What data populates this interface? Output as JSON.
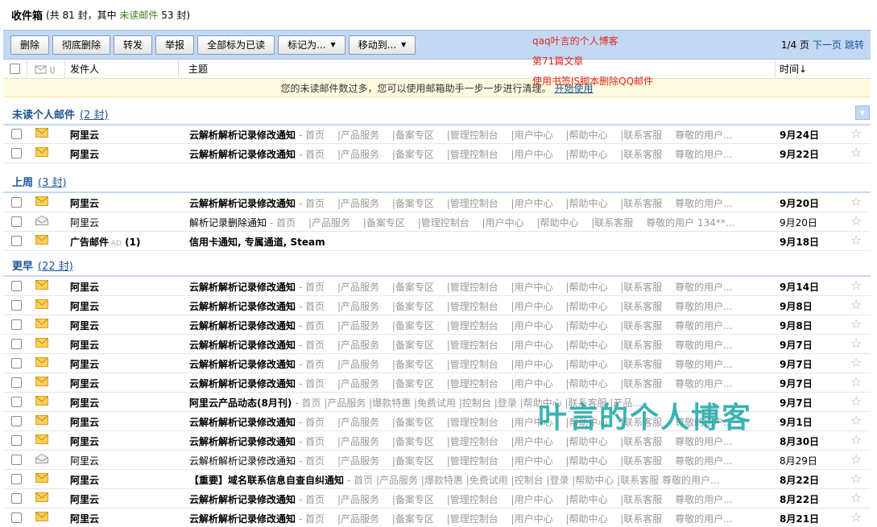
{
  "topbar": {
    "title": "收件箱",
    "summary_prefix": "(共 81 封，其中 ",
    "unread_label": "未读邮件",
    "summary_suffix": " 53 封)"
  },
  "toolbar": {
    "delete": "删除",
    "perm_delete": "彻底删除",
    "forward": "转发",
    "report": "举报",
    "mark_all_read": "全部标为已读",
    "mark_as": "标记为...",
    "move_to": "移动到...",
    "page_info": "1/4 页",
    "next_page": "下一页",
    "jump": "跳转"
  },
  "header": {
    "from": "发件人",
    "subject": "主题",
    "time": "时间↓"
  },
  "notice": {
    "text": "您的未读邮件数过多，您可以使用邮箱助手一步一步进行清理。",
    "link": "开始使用"
  },
  "overlay": {
    "line1": "qaq叶言的个人博客",
    "line2": "第71篇文章",
    "line3": "使用书签JS脚本删除QQ邮件",
    "watermark": "叶言的个人博客"
  },
  "groups": [
    {
      "title": "未读个人邮件",
      "count": "(2 封)"
    },
    {
      "title": "上周",
      "count": "(3 封)"
    },
    {
      "title": "更早",
      "count": "(22 封)"
    }
  ],
  "rows": [
    {
      "from": "阿里云",
      "subject": "云解析解析记录修改通知",
      "preview": "- 首页 　|产品服务 　|备案专区 　|管理控制台 　|用户中心 　|帮助中心 　|联系客服 　尊敬的用户...",
      "time": "9月24日",
      "unread": true
    },
    {
      "from": "阿里云",
      "subject": "云解析解析记录修改通知",
      "preview": "- 首页 　|产品服务 　|备案专区 　|管理控制台 　|用户中心 　|帮助中心 　|联系客服 　尊敬的用户...",
      "time": "9月22日",
      "unread": true
    },
    {
      "from": "阿里云",
      "subject": "云解析解析记录修改通知",
      "preview": "- 首页 　|产品服务 　|备案专区 　|管理控制台 　|用户中心 　|帮助中心 　|联系客服 　尊敬的用户...",
      "time": "9月20日",
      "unread": true
    },
    {
      "from": "阿里云",
      "subject": "解析记录删除通知",
      "preview": "- 首页 　|产品服务 　|备案专区 　|管理控制台 　|用户中心 　|帮助中心 　|联系客服 　尊敬的用户 134**...",
      "time": "9月20日",
      "unread": false
    },
    {
      "from": "广告邮件",
      "ad": "AD",
      "badge": "(1)",
      "subject": "信用卡通知, 专属通道, Steam",
      "preview": "",
      "time": "9月18日",
      "unread": true
    },
    {
      "from": "阿里云",
      "subject": "云解析解析记录修改通知",
      "preview": "- 首页 　|产品服务 　|备案专区 　|管理控制台 　|用户中心 　|帮助中心 　|联系客服 　尊敬的用户...",
      "time": "9月14日",
      "unread": true
    },
    {
      "from": "阿里云",
      "subject": "云解析解析记录修改通知",
      "preview": "- 首页 　|产品服务 　|备案专区 　|管理控制台 　|用户中心 　|帮助中心 　|联系客服 　尊敬的用户...",
      "time": "9月8日",
      "unread": true
    },
    {
      "from": "阿里云",
      "subject": "云解析解析记录修改通知",
      "preview": "- 首页 　|产品服务 　|备案专区 　|管理控制台 　|用户中心 　|帮助中心 　|联系客服 　尊敬的用户...",
      "time": "9月8日",
      "unread": true
    },
    {
      "from": "阿里云",
      "subject": "云解析解析记录修改通知",
      "preview": "- 首页 　|产品服务 　|备案专区 　|管理控制台 　|用户中心 　|帮助中心 　|联系客服 　尊敬的用户...",
      "time": "9月7日",
      "unread": true
    },
    {
      "from": "阿里云",
      "subject": "云解析解析记录修改通知",
      "preview": "- 首页 　|产品服务 　|备案专区 　|管理控制台 　|用户中心 　|帮助中心 　|联系客服 　尊敬的用户...",
      "time": "9月7日",
      "unread": true
    },
    {
      "from": "阿里云",
      "subject": "云解析解析记录修改通知",
      "preview": "- 首页 　|产品服务 　|备案专区 　|管理控制台 　|用户中心 　|帮助中心 　|联系客服 　尊敬的用户...",
      "time": "9月7日",
      "unread": true
    },
    {
      "from": "阿里云",
      "subject": "阿里云产品动态(8月刊)",
      "preview": "- 首页 |产品服务 |爆款特惠 |免费试用 |控制台 |登录 |帮助中心 |联系客服 |产品...",
      "time": "9月7日",
      "unread": true
    },
    {
      "from": "阿里云",
      "subject": "云解析解析记录修改通知",
      "preview": "- 首页 　|产品服务 　|备案专区 　|管理控制台 　|用户中心 　|帮助中心 　|联系客服 　尊敬的用户...",
      "time": "9月1日",
      "unread": true
    },
    {
      "from": "阿里云",
      "subject": "云解析解析记录修改通知",
      "preview": "- 首页 　|产品服务 　|备案专区 　|管理控制台 　|用户中心 　|帮助中心 　|联系客服 　尊敬的用户...",
      "time": "8月30日",
      "unread": true
    },
    {
      "from": "阿里云",
      "subject": "云解析解析记录修改通知",
      "preview": "- 首页 　|产品服务 　|备案专区 　|管理控制台 　|用户中心 　|帮助中心 　|联系客服 　尊敬的用户...",
      "time": "8月29日",
      "unread": false
    },
    {
      "from": "阿里云",
      "subject": "【重要】域名联系信息自查自纠通知",
      "preview": "- 首页 |产品服务 |爆款特惠 |免费试用 |控制台 |登录 |帮助中心 |联系客服 尊敬的用户...",
      "time": "8月22日",
      "unread": true
    },
    {
      "from": "阿里云",
      "subject": "云解析解析记录修改通知",
      "preview": "- 首页 　|产品服务 　|备案专区 　|管理控制台 　|用户中心 　|帮助中心 　|联系客服 　尊敬的用户...",
      "time": "8月22日",
      "unread": true
    },
    {
      "from": "阿里云",
      "subject": "云解析解析记录修改通知",
      "preview": "- 首页 　|产品服务 　|备案专区 　|管理控制台 　|用户中心 　|帮助中心 　|联系客服 　尊敬的用户...",
      "time": "8月21日",
      "unread": true
    }
  ],
  "colors": {
    "toolbar_bg": "#c3d9f3",
    "link": "#1e5494",
    "unread_green": "#40801e",
    "mail_icon": "#f3c043",
    "overlay_red": "#e0281e",
    "watermark": "#19a6a6"
  },
  "icons": {
    "unread": "envelope-closed-icon",
    "read": "envelope-open-icon",
    "star": "star-outline-icon"
  }
}
